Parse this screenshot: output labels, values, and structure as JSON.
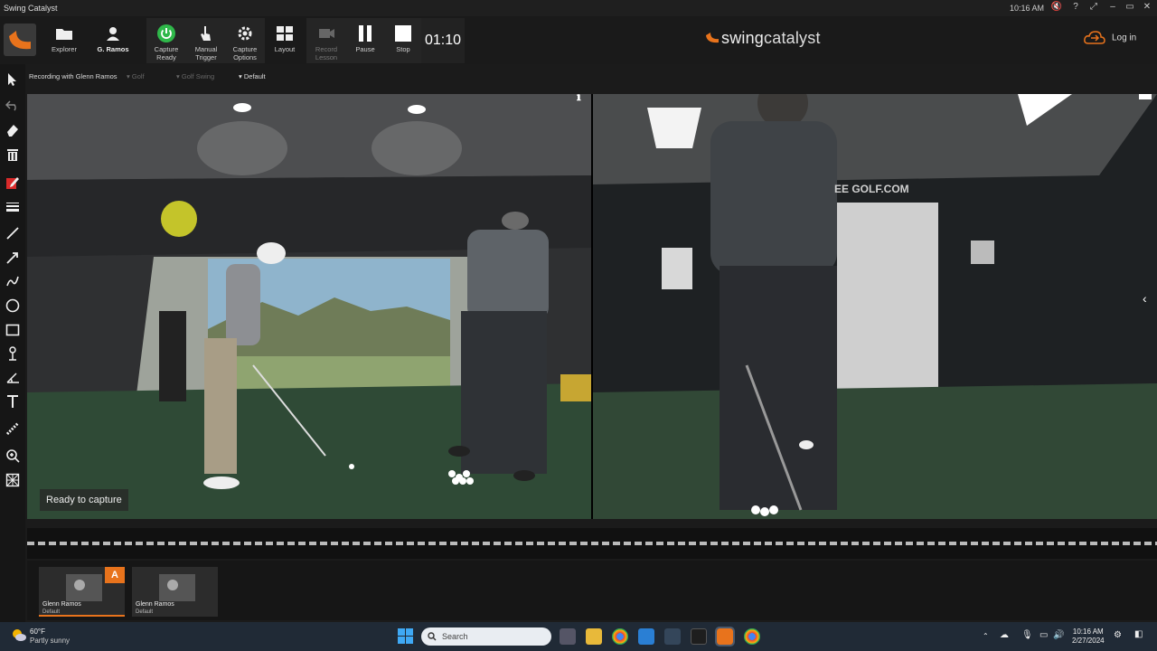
{
  "window": {
    "title": "Swing Catalyst",
    "time": "10:16 AM",
    "controls": [
      "🔇",
      "?",
      "⤢",
      "–",
      "▭",
      "✕"
    ]
  },
  "toolbar": {
    "explorer": "Explorer",
    "profile": "G. Ramos",
    "capture_ready": "Capture Ready",
    "manual_trigger": "Manual Trigger",
    "capture_options": "Capture Options",
    "layout": "Layout",
    "record_lesson": "Record Lesson",
    "pause": "Pause",
    "stop": "Stop",
    "timer": "01:10",
    "brand_prefix": "swing",
    "brand_suffix": "catalyst",
    "login": "Log in",
    "accent": "#e8731c",
    "ready_green": "#2fb84a"
  },
  "subbar": {
    "recording": "Recording with Glenn Ramos",
    "sport": "Golf",
    "activity": "Golf Swing",
    "preset": "Default"
  },
  "sidebar": {
    "tools": [
      "cursor-icon",
      "undo-icon",
      "eraser-icon",
      "trash-icon",
      "pen-color-icon",
      "line-weight-icon",
      "line-icon",
      "arrow-icon",
      "freehand-icon",
      "circle-icon",
      "rectangle-icon",
      "body-angle-icon",
      "angle-icon",
      "text-icon",
      "measure-icon",
      "zoom-icon",
      "grid-icon"
    ]
  },
  "viewport": {
    "status": "Ready to capture",
    "right_wall_text": "EE GOLF.COM"
  },
  "recordings": [
    {
      "name": "Glenn Ramos",
      "preset": "Default",
      "badge": "A"
    },
    {
      "name": "Glenn Ramos",
      "preset": "Default"
    }
  ],
  "taskbar": {
    "temperature": "60°F",
    "condition": "Partly sunny",
    "search_placeholder": "Search",
    "clock_time": "10:16 AM",
    "clock_date": "2/27/2024"
  }
}
